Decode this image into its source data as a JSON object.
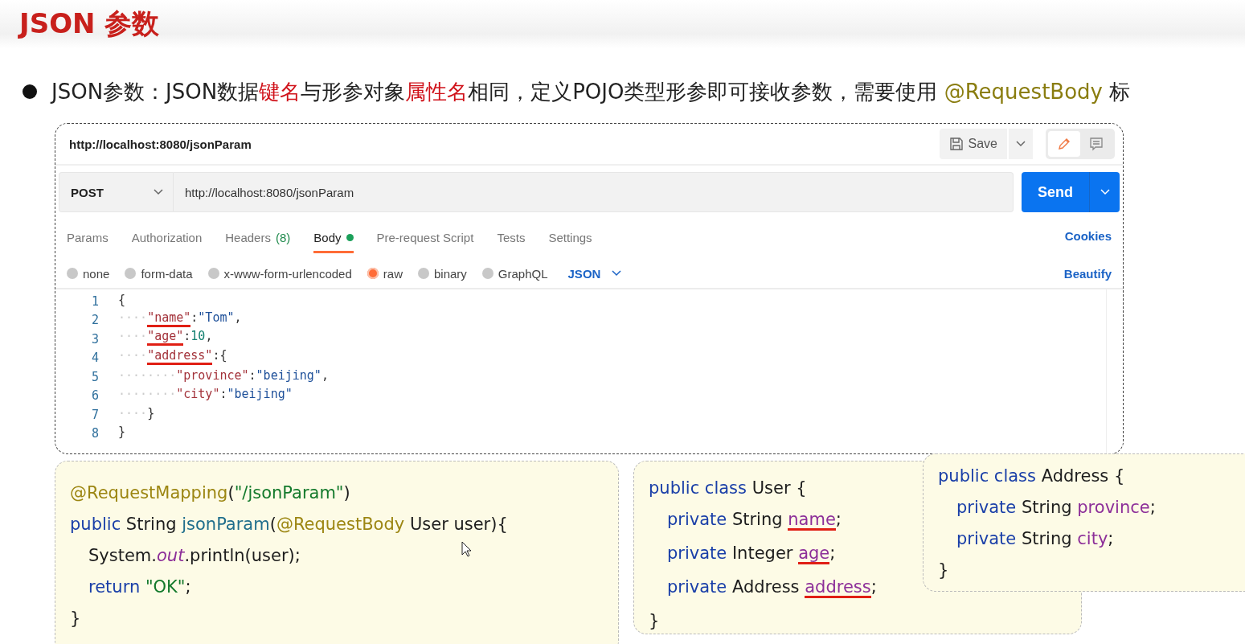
{
  "title": "JSON 参数",
  "bullet": [
    {
      "text": "JSON参数：JSON数据",
      "kind": "plain"
    },
    {
      "text": "键名",
      "kind": "highlight"
    },
    {
      "text": "与形参对象",
      "kind": "plain"
    },
    {
      "text": "属性名",
      "kind": "highlight"
    },
    {
      "text": "相同，定义POJO类型形参即可接收参数，需要使用 ",
      "kind": "plain"
    },
    {
      "text": "@RequestBody",
      "kind": "annotation"
    },
    {
      "text": " 标",
      "kind": "plain"
    }
  ],
  "postman": {
    "request_name": "http://localhost:8080/jsonParam",
    "save_button": "Save",
    "method": "POST",
    "url": "http://localhost:8080/jsonParam",
    "send_button": "Send",
    "tabs": [
      {
        "label": "Params",
        "selected": false,
        "has_content": false
      },
      {
        "label": "Authorization",
        "selected": false,
        "has_content": false
      },
      {
        "label": "Headers",
        "count": "(8)",
        "selected": false,
        "has_content": false
      },
      {
        "label": "Body",
        "selected": true,
        "has_content": true
      },
      {
        "label": "Pre-request Script",
        "selected": false,
        "has_content": false
      },
      {
        "label": "Tests",
        "selected": false,
        "has_content": false
      },
      {
        "label": "Settings",
        "selected": false,
        "has_content": false
      }
    ],
    "cookies_link": "Cookies",
    "body_types": [
      {
        "label": "none",
        "selected": false
      },
      {
        "label": "form-data",
        "selected": false
      },
      {
        "label": "x-www-form-urlencoded",
        "selected": false
      },
      {
        "label": "raw",
        "selected": true
      },
      {
        "label": "binary",
        "selected": false
      },
      {
        "label": "GraphQL",
        "selected": false
      }
    ],
    "format": "JSON",
    "beautify_link": "Beautify",
    "editor_lines": [
      {
        "number": "1",
        "tokens": [
          {
            "text": "{",
            "kind": "punct"
          }
        ]
      },
      {
        "number": "2",
        "tokens": [
          {
            "text": "····",
            "kind": "ws"
          },
          {
            "text": "\"name\"",
            "kind": "key",
            "underlined": true
          },
          {
            "text": ":",
            "kind": "punct"
          },
          {
            "text": "\"Tom\"",
            "kind": "str"
          },
          {
            "text": ",",
            "kind": "punct"
          }
        ]
      },
      {
        "number": "3",
        "tokens": [
          {
            "text": "····",
            "kind": "ws"
          },
          {
            "text": "\"age\"",
            "kind": "key",
            "underlined": true
          },
          {
            "text": ":",
            "kind": "punct"
          },
          {
            "text": "10",
            "kind": "num"
          },
          {
            "text": ",",
            "kind": "punct"
          }
        ]
      },
      {
        "number": "4",
        "tokens": [
          {
            "text": "····",
            "kind": "ws"
          },
          {
            "text": "\"address\"",
            "kind": "key",
            "underlined": true
          },
          {
            "text": ":{",
            "kind": "punct"
          }
        ]
      },
      {
        "number": "5",
        "tokens": [
          {
            "text": "········",
            "kind": "ws"
          },
          {
            "text": "\"province\"",
            "kind": "key",
            "underlined": false
          },
          {
            "text": ":",
            "kind": "punct"
          },
          {
            "text": "\"beijing\"",
            "kind": "str"
          },
          {
            "text": ",",
            "kind": "punct"
          }
        ]
      },
      {
        "number": "6",
        "tokens": [
          {
            "text": "········",
            "kind": "ws"
          },
          {
            "text": "\"city\"",
            "kind": "key",
            "underlined": false
          },
          {
            "text": ":",
            "kind": "punct"
          },
          {
            "text": "\"beijing\"",
            "kind": "str"
          }
        ]
      },
      {
        "number": "7",
        "tokens": [
          {
            "text": "····",
            "kind": "ws"
          },
          {
            "text": "}",
            "kind": "punct"
          }
        ]
      },
      {
        "number": "8",
        "tokens": [
          {
            "text": "}",
            "kind": "punct"
          }
        ]
      }
    ]
  },
  "code_cards": [
    {
      "lines": [
        {
          "tokens": [
            {
              "text": "@RequestMapping",
              "kind": "annotation"
            },
            {
              "text": "(",
              "kind": "plain"
            },
            {
              "text": "\"/jsonParam\"",
              "kind": "string"
            },
            {
              "text": ")",
              "kind": "plain"
            }
          ]
        },
        {
          "tokens": [
            {
              "text": "public",
              "kind": "keyword"
            },
            {
              "text": " String ",
              "kind": "plain"
            },
            {
              "text": "jsonParam",
              "kind": "method"
            },
            {
              "text": "(",
              "kind": "plain"
            },
            {
              "text": "@RequestBody",
              "kind": "annotation"
            },
            {
              "text": " User user){",
              "kind": "plain"
            }
          ],
          "children": [
            {
              "tokens": [
                {
                  "text": "System.",
                  "kind": "plain"
                },
                {
                  "text": "out",
                  "kind": "static"
                },
                {
                  "text": ".println(user);",
                  "kind": "plain"
                }
              ]
            },
            {
              "tokens": [
                {
                  "text": "return ",
                  "kind": "keyword"
                },
                {
                  "text": "\"OK\"",
                  "kind": "string"
                },
                {
                  "text": ";",
                  "kind": "plain"
                }
              ]
            }
          ]
        },
        {
          "tokens": [
            {
              "text": "}",
              "kind": "plain"
            }
          ]
        }
      ]
    },
    {
      "lines": [
        {
          "tokens": [
            {
              "text": "public class",
              "kind": "keyword"
            },
            {
              "text": " User {",
              "kind": "plain"
            }
          ],
          "children": [
            {
              "tokens": [
                {
                  "text": "private",
                  "kind": "keyword"
                },
                {
                  "text": " String ",
                  "kind": "plain"
                },
                {
                  "text": "name",
                  "kind": "field",
                  "underlined": true
                },
                {
                  "text": ";",
                  "kind": "plain"
                }
              ]
            },
            {
              "tokens": [
                {
                  "text": "private",
                  "kind": "keyword"
                },
                {
                  "text": " Integer ",
                  "kind": "plain"
                },
                {
                  "text": "age",
                  "kind": "field",
                  "underlined": true
                },
                {
                  "text": ";",
                  "kind": "plain"
                }
              ]
            },
            {
              "tokens": [
                {
                  "text": "private",
                  "kind": "keyword"
                },
                {
                  "text": " Address ",
                  "kind": "plain"
                },
                {
                  "text": "address",
                  "kind": "field",
                  "underlined": true
                },
                {
                  "text": ";",
                  "kind": "plain"
                }
              ]
            }
          ]
        },
        {
          "tokens": [
            {
              "text": "}",
              "kind": "plain"
            }
          ]
        }
      ]
    },
    {
      "lines": [
        {
          "tokens": [
            {
              "text": "public class",
              "kind": "keyword"
            },
            {
              "text": " Address {",
              "kind": "plain"
            }
          ],
          "children": [
            {
              "tokens": [
                {
                  "text": "private",
                  "kind": "keyword"
                },
                {
                  "text": " String ",
                  "kind": "plain"
                },
                {
                  "text": "province",
                  "kind": "field",
                  "underlined": false
                },
                {
                  "text": ";",
                  "kind": "plain"
                }
              ]
            },
            {
              "tokens": [
                {
                  "text": "private",
                  "kind": "keyword"
                },
                {
                  "text": " String ",
                  "kind": "plain"
                },
                {
                  "text": "city",
                  "kind": "field",
                  "underlined": false
                },
                {
                  "text": ";",
                  "kind": "plain"
                }
              ]
            }
          ]
        },
        {
          "tokens": [
            {
              "text": "}",
              "kind": "plain"
            }
          ]
        }
      ]
    }
  ]
}
